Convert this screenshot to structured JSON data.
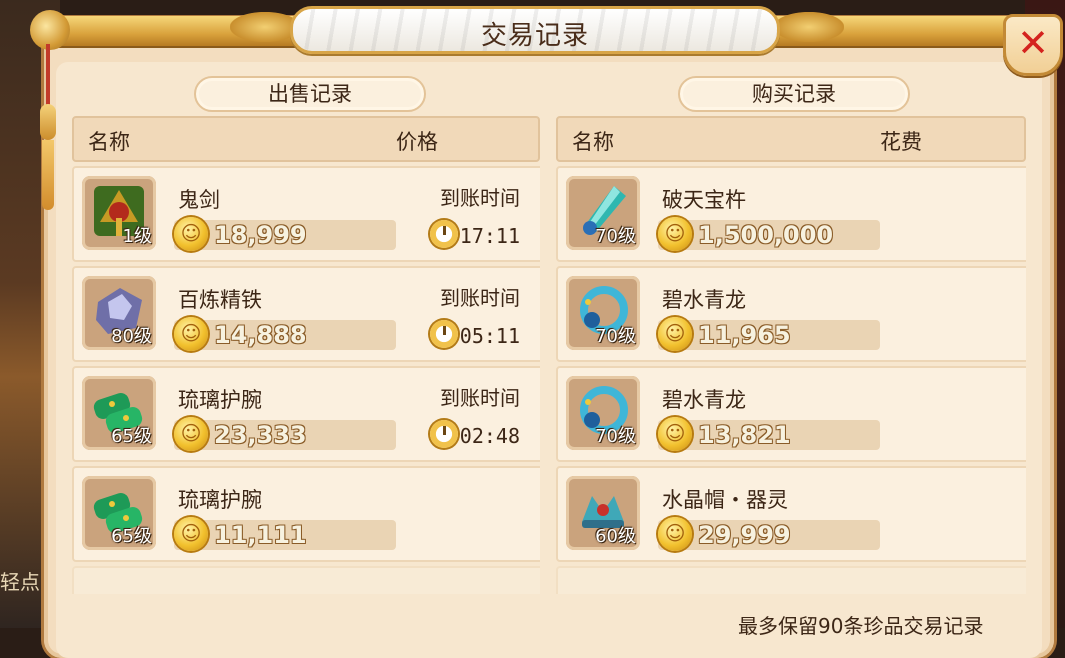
{
  "window": {
    "title": "交易记录"
  },
  "background": {
    "left_text": "轻点"
  },
  "sell": {
    "header": "出售记录",
    "columns": {
      "name": "名称",
      "price": "价格"
    },
    "items": [
      {
        "name": "鬼剑",
        "level": "1级",
        "price": "18,999",
        "arrive_label": "到账时间",
        "arrive_time": "17:11",
        "icon": "ghost-sword-icon"
      },
      {
        "name": "百炼精铁",
        "level": "80级",
        "price": "14,888",
        "arrive_label": "到账时间",
        "arrive_time": "05:11",
        "icon": "refined-iron-icon"
      },
      {
        "name": "琉璃护腕",
        "level": "65级",
        "price": "23,333",
        "arrive_label": "到账时间",
        "arrive_time": "02:48",
        "icon": "glazed-bracer-icon"
      },
      {
        "name": "琉璃护腕",
        "level": "65级",
        "price": "11,111",
        "icon": "glazed-bracer-icon"
      }
    ]
  },
  "buy": {
    "header": "购买记录",
    "columns": {
      "name": "名称",
      "cost": "花费"
    },
    "items": [
      {
        "name": "破天宝杵",
        "level": "70级",
        "price": "1,500,000",
        "icon": "crystal-pestle-icon"
      },
      {
        "name": "碧水青龙",
        "level": "70级",
        "price": "11,965",
        "icon": "azure-dragon-ring-icon"
      },
      {
        "name": "碧水青龙",
        "level": "70级",
        "price": "13,821",
        "icon": "azure-dragon-ring-icon"
      },
      {
        "name": "水晶帽・器灵",
        "level": "60级",
        "price": "29,999",
        "icon": "crystal-hat-icon"
      }
    ]
  },
  "footer": {
    "note": "最多保留90条珍品交易记录"
  },
  "colors": {
    "panel": "#f3ddbf",
    "gold": "#d9a23c",
    "close_x": "#d4231e",
    "price_text": "#f7f2e0"
  }
}
